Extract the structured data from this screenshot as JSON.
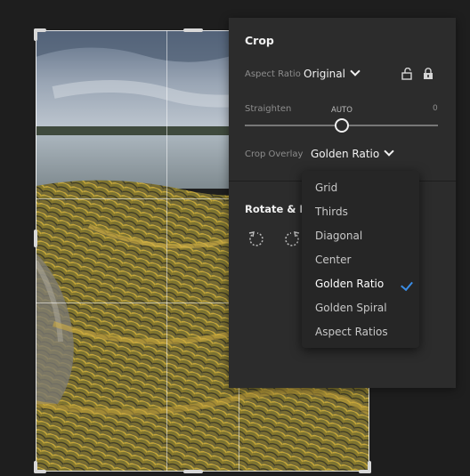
{
  "crop_panel": {
    "title": "Crop",
    "aspect_ratio": {
      "label": "Aspect Ratio",
      "value": "Original"
    },
    "straighten": {
      "label": "Straighten",
      "auto_label": "AUTO",
      "value_text": "0"
    },
    "crop_overlay": {
      "label": "Crop Overlay",
      "value": "Golden Ratio"
    },
    "rotate_flip": {
      "title": "Rotate & Fli"
    }
  },
  "overlay_menu": {
    "items": [
      {
        "label": "Grid"
      },
      {
        "label": "Thirds"
      },
      {
        "label": "Diagonal"
      },
      {
        "label": "Center"
      },
      {
        "label": "Golden Ratio",
        "selected": true
      },
      {
        "label": "Golden Spiral"
      },
      {
        "label": "Aspect Ratios"
      }
    ]
  },
  "colors": {
    "accent_check": "#3a8de6",
    "panel_bg": "#2c2c2c",
    "menu_bg": "#262626"
  },
  "icons": [
    "lock-open-icon",
    "lock-closed-icon",
    "rotate-left-icon",
    "rotate-right-icon",
    "checkmark-icon"
  ]
}
